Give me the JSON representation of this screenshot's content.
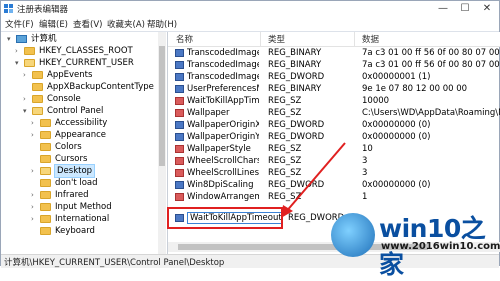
{
  "window": {
    "title": "注册表编辑器",
    "controls": {
      "minimize": "—",
      "maximize": "☐",
      "close": "✕"
    }
  },
  "menu": [
    "文件(F)",
    "编辑(E)",
    "查看(V)",
    "收藏夹(A)",
    "帮助(H)"
  ],
  "tree": {
    "items": [
      {
        "label": "计算机",
        "icon": "computer-icon",
        "arrow": "▾"
      },
      {
        "label": "HKEY_CLASSES_ROOT",
        "icon": "folder-icon",
        "arrow": "›"
      },
      {
        "label": "HKEY_CURRENT_USER",
        "icon": "folder-icon",
        "arrow": "▾"
      },
      {
        "label": "AppEvents",
        "icon": "folder-icon",
        "arrow": "›"
      },
      {
        "label": "AppXBackupContentType",
        "icon": "folder-icon",
        "arrow": ""
      },
      {
        "label": "Console",
        "icon": "folder-icon",
        "arrow": "›"
      },
      {
        "label": "Control Panel",
        "icon": "folder-icon",
        "arrow": "▾"
      },
      {
        "label": "Accessibility",
        "icon": "folder-icon",
        "arrow": "›"
      },
      {
        "label": "Appearance",
        "icon": "folder-icon",
        "arrow": "›"
      },
      {
        "label": "Colors",
        "icon": "folder-icon",
        "arrow": ""
      },
      {
        "label": "Cursors",
        "icon": "folder-icon",
        "arrow": ""
      },
      {
        "label": "Desktop",
        "icon": "folder-icon",
        "arrow": "›"
      },
      {
        "label": "don't load",
        "icon": "folder-icon",
        "arrow": ""
      },
      {
        "label": "Infrared",
        "icon": "folder-icon",
        "arrow": "›"
      },
      {
        "label": "Input Method",
        "icon": "folder-icon",
        "arrow": "›"
      },
      {
        "label": "International",
        "icon": "folder-icon",
        "arrow": "›"
      },
      {
        "label": "Keyboard",
        "icon": "folder-icon",
        "arrow": ""
      }
    ],
    "selected": "Desktop"
  },
  "list": {
    "columns": [
      "名称",
      "类型",
      "数据"
    ],
    "rows": [
      {
        "name": "TranscodedImageC...",
        "type": "REG_BINARY",
        "data": "7a c3 01 00 ff 56 0f 00 80 07 00 00",
        "kind": "bin"
      },
      {
        "name": "TranscodedImageC...",
        "type": "REG_BINARY",
        "data": "7a c3 01 00 ff 56 0f 00 80 07 00 00",
        "kind": "bin"
      },
      {
        "name": "TranscodedImageC...",
        "type": "REG_DWORD",
        "data": "0x00000001 (1)",
        "kind": "bin"
      },
      {
        "name": "UserPreferencesMa...",
        "type": "REG_BINARY",
        "data": "9e 1e 07 80 12 00 00 00",
        "kind": "bin"
      },
      {
        "name": "WaitToKillAppTime...",
        "type": "REG_SZ",
        "data": "10000",
        "kind": "sz"
      },
      {
        "name": "Wallpaper",
        "type": "REG_SZ",
        "data": "C:\\Users\\WD\\AppData\\Roaming\\M",
        "kind": "sz"
      },
      {
        "name": "WallpaperOriginX",
        "type": "REG_DWORD",
        "data": "0x00000000 (0)",
        "kind": "bin"
      },
      {
        "name": "WallpaperOriginY",
        "type": "REG_DWORD",
        "data": "0x00000000 (0)",
        "kind": "bin"
      },
      {
        "name": "WallpaperStyle",
        "type": "REG_SZ",
        "data": "10",
        "kind": "sz"
      },
      {
        "name": "WheelScrollChars",
        "type": "REG_SZ",
        "data": "3",
        "kind": "sz"
      },
      {
        "name": "WheelScrollLines",
        "type": "REG_SZ",
        "data": "3",
        "kind": "sz"
      },
      {
        "name": "Win8DpiScaling",
        "type": "REG_DWORD",
        "data": "0x00000000 (0)",
        "kind": "bin"
      },
      {
        "name": "WindowArrangeme...",
        "type": "REG_SZ",
        "data": "1",
        "kind": "sz"
      },
      {
        "name": "WaitToKillAppTimeout",
        "type": "REG_DWORD",
        "data": "",
        "kind": "bin"
      }
    ],
    "editing_row": "WaitToKillAppTimeout"
  },
  "status": "计算机\\HKEY_CURRENT_USER\\Control Panel\\Desktop",
  "watermark": {
    "title": "win10之家",
    "url": "www.2016win10.com"
  },
  "colors": {
    "highlight": "#e02020",
    "selection": "#cce8ff",
    "watermark_blue": "#0a4fa0"
  }
}
